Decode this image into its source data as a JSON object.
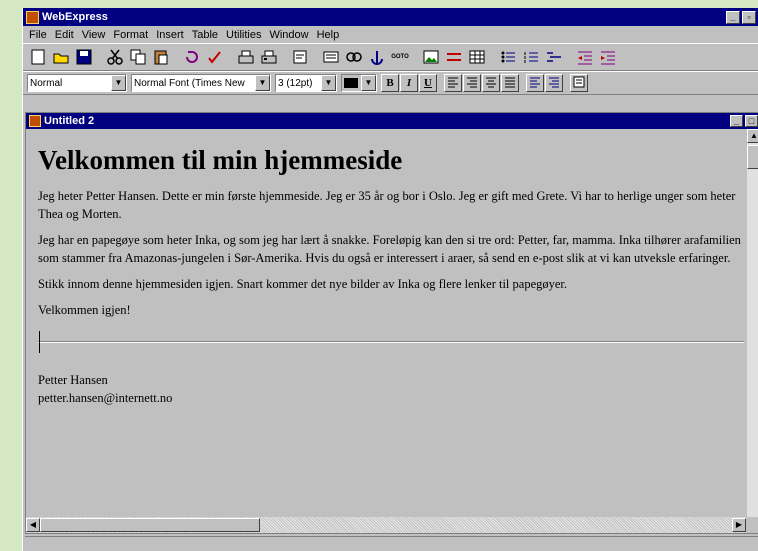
{
  "app": {
    "title": "WebExpress"
  },
  "menu": [
    "File",
    "Edit",
    "View",
    "Format",
    "Insert",
    "Table",
    "Utilities",
    "Window",
    "Help"
  ],
  "toolbar": {
    "icons": [
      "new-icon",
      "open-icon",
      "save-icon",
      "cut-icon",
      "copy-icon",
      "paste-icon",
      "undo-icon",
      "spellcheck-icon",
      "print-preview-icon",
      "print-icon",
      "properties-icon",
      "form-icon",
      "link-icon",
      "anchor-icon",
      "goto-icon",
      "image-icon",
      "horizontal-rule-icon",
      "table-icon",
      "bullet-list-icon",
      "numbered-list-icon",
      "definition-list-icon",
      "outdent-icon",
      "indent-icon"
    ],
    "goto_label": "GOTO"
  },
  "format": {
    "style": "Normal",
    "font": "Normal Font  (Times New",
    "size": "3  (12pt)",
    "bold": "B",
    "italic": "I",
    "underline": "U"
  },
  "document": {
    "title": "Untitled 2",
    "heading": "Velkommen til min hjemmeside",
    "paragraphs": [
      "Jeg heter Petter Hansen. Dette er min første hjemmeside. Jeg er 35 år og bor i Oslo. Jeg er gift med Grete. Vi har to herlige unger som heter Thea og Morten.",
      "Jeg har en papegøye som heter Inka, og som jeg har lært å snakke. Foreløpig kan den si tre ord: Petter, far, mamma. Inka tilhører arafamilien som stammer fra Amazonas-jungelen i Sør-Amerika. Hvis du også er interessert i araer, så send en e-post slik at vi kan utveksle erfaringer.",
      "Stikk innom denne hjemmesiden igjen. Snart kommer det nye bilder av Inka og flere lenker til papegøyer.",
      "Velkommen igjen!"
    ],
    "signature_name": "Petter Hansen",
    "signature_email": "petter.hansen@internett.no"
  },
  "colors": {
    "titlebar": "#000080",
    "chrome": "#c0c0c0",
    "desktop": "#d4e8c4"
  }
}
